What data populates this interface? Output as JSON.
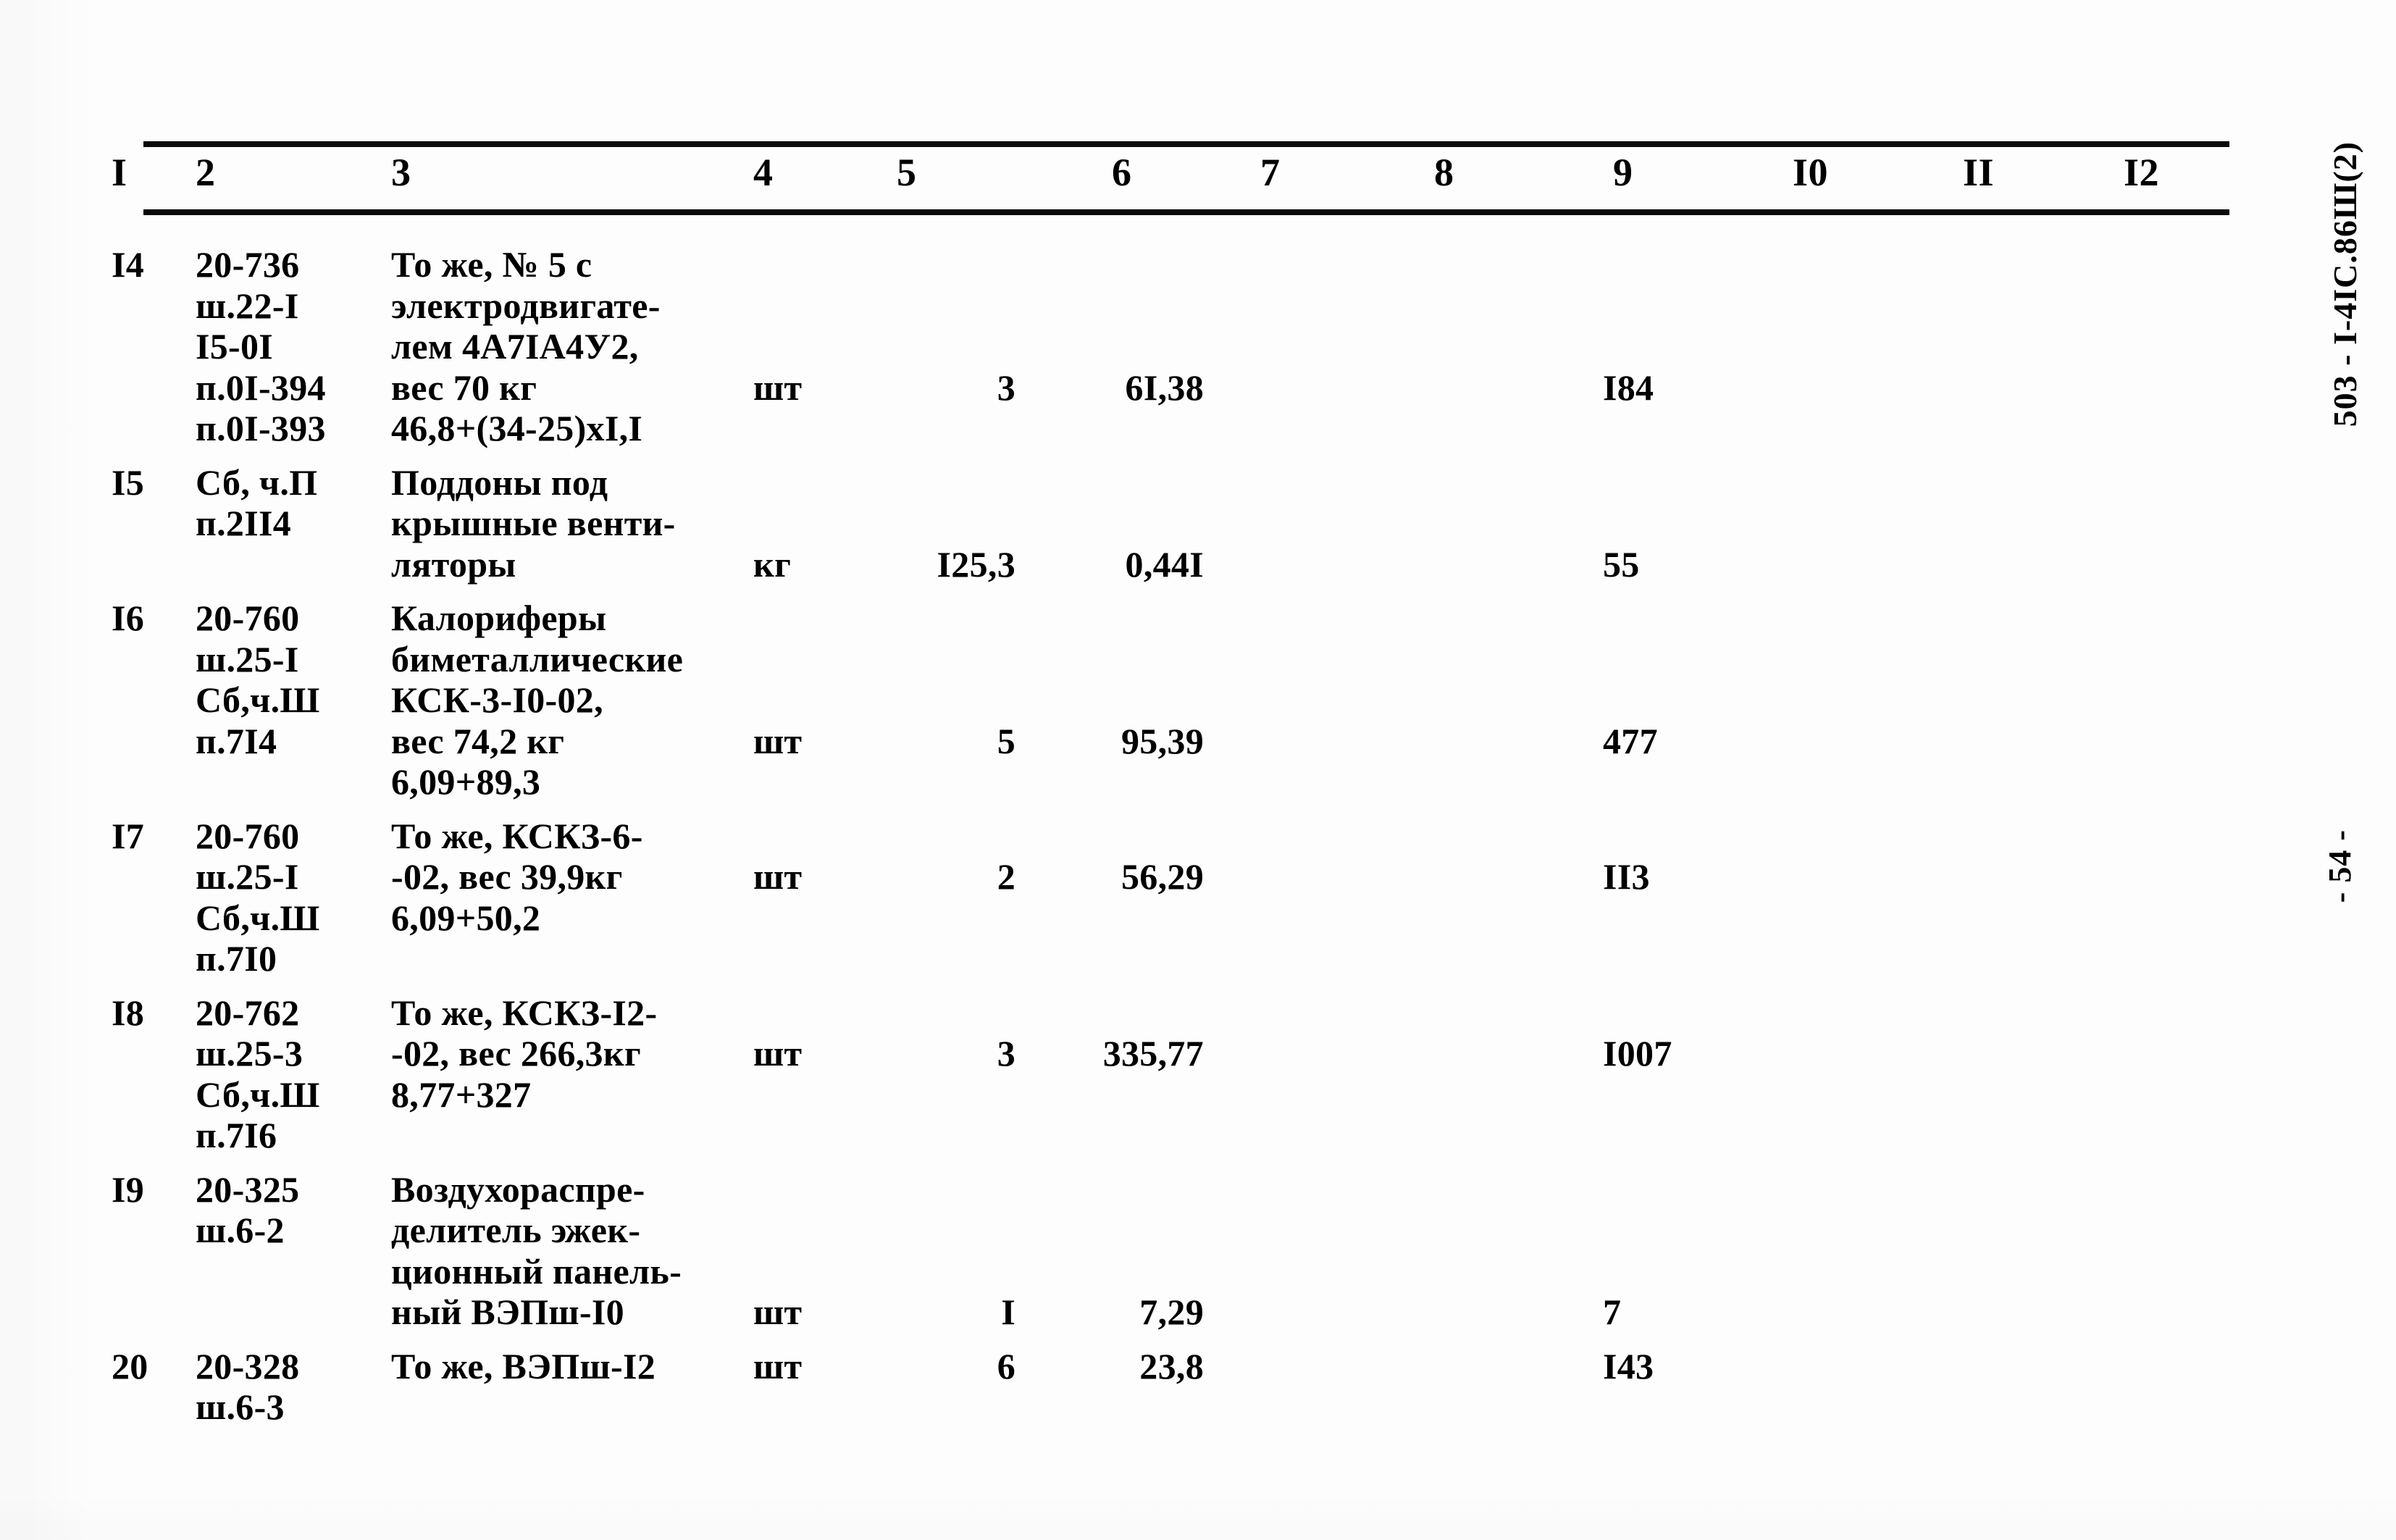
{
  "document": {
    "code_vertical": "503 - I-4IC.86Ш(2)",
    "page_number_vertical": "- 54 -"
  },
  "table": {
    "column_headers": [
      "I",
      "2",
      "3",
      "4",
      "5",
      "6",
      "7",
      "8",
      "9",
      "I0",
      "II",
      "I2"
    ],
    "rows": [
      {
        "c1": "I4",
        "c2": "20-736\nш.22-I\nI5-0I\nп.0I-394\nп.0I-393",
        "c3": "То же, № 5 с\nэлектродвигате-\nлем 4А7IА4У2,\nвес 70 кг\n46,8+(34-25)хI,I",
        "c4": "шт",
        "c5": "3",
        "c6": "6I,38",
        "c7": "",
        "c8": "",
        "c9": "I84",
        "c10": "",
        "c11": "",
        "c12": "",
        "unit_offset_lines": 3,
        "value_offset_lines": 3
      },
      {
        "c1": "I5",
        "c2": "Сб, ч.П\nп.2II4",
        "c3": "Поддоны под\nкрышные венти-\nляторы",
        "c4": "кг",
        "c5": "I25,3",
        "c6": "0,44I",
        "c7": "",
        "c8": "",
        "c9": "55",
        "c10": "",
        "c11": "",
        "c12": "",
        "unit_offset_lines": 2,
        "value_offset_lines": 2
      },
      {
        "c1": "I6",
        "c2": "20-760\nш.25-I\nСб,ч.Ш\nп.7I4",
        "c3": "Калориферы\nбиметаллические\nКСК-3-I0-02,\nвес 74,2 кг\n6,09+89,3",
        "c4": "шт",
        "c5": "5",
        "c6": "95,39",
        "c7": "",
        "c8": "",
        "c9": "477",
        "c10": "",
        "c11": "",
        "c12": "",
        "unit_offset_lines": 3,
        "value_offset_lines": 3
      },
      {
        "c1": "I7",
        "c2": "20-760\nш.25-I\nСб,ч.Ш\nп.7I0",
        "c3": "То же, КСКЗ-6-\n-02, вес 39,9кг\n6,09+50,2",
        "c4": "шт",
        "c5": "2",
        "c6": "56,29",
        "c7": "",
        "c8": "",
        "c9": "II3",
        "c10": "",
        "c11": "",
        "c12": "",
        "unit_offset_lines": 1,
        "value_offset_lines": 1
      },
      {
        "c1": "I8",
        "c2": "20-762\nш.25-3\nСб,ч.Ш\nп.7I6",
        "c3": "То же, КСКЗ-I2-\n-02, вес 266,3кг\n8,77+327",
        "c4": "шт",
        "c5": "3",
        "c6": "335,77",
        "c7": "",
        "c8": "",
        "c9": "I007",
        "c10": "",
        "c11": "",
        "c12": "",
        "unit_offset_lines": 1,
        "value_offset_lines": 1
      },
      {
        "c1": "I9",
        "c2": "20-325\nш.6-2",
        "c3": "Воздухораспре-\nделитель эжек-\nционный панель-\nный ВЭПш-I0",
        "c4": "шт",
        "c5": "I",
        "c6": "7,29",
        "c7": "",
        "c8": "",
        "c9": "7",
        "c10": "",
        "c11": "",
        "c12": "",
        "unit_offset_lines": 3,
        "value_offset_lines": 3
      },
      {
        "c1": "20",
        "c2": "20-328\nш.6-3",
        "c3": "То же, ВЭПш-I2",
        "c4": "шт",
        "c5": "6",
        "c6": "23,8",
        "c7": "",
        "c8": "",
        "c9": "I43",
        "c10": "",
        "c11": "",
        "c12": "",
        "unit_offset_lines": 0,
        "value_offset_lines": 0
      }
    ]
  }
}
